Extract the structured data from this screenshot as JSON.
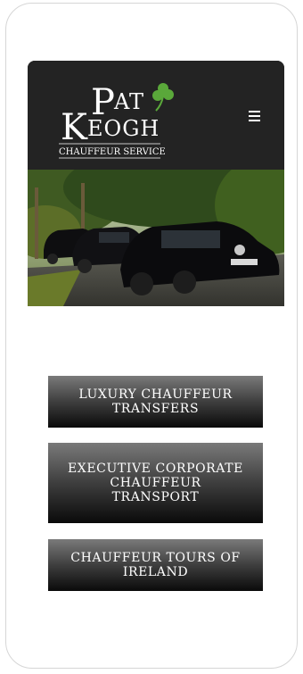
{
  "brand": {
    "name_first": "Pat",
    "name_last": "Keogh",
    "tagline": "CHAUFFEUR SERVICE",
    "primary_color": "#232323",
    "shamrock_color": "#5aa83a"
  },
  "header": {
    "menu_icon": "hamburger-menu-icon"
  },
  "hero": {
    "subject": "row of black Mercedes cars on a tree-lined road"
  },
  "services": [
    {
      "label": "LUXURY CHAUFFEUR TRANSFERS"
    },
    {
      "label": "EXECUTIVE CORPORATE CHAUFFEUR TRANSPORT"
    },
    {
      "label": "CHAUFFEUR TOURS OF IRELAND"
    }
  ]
}
